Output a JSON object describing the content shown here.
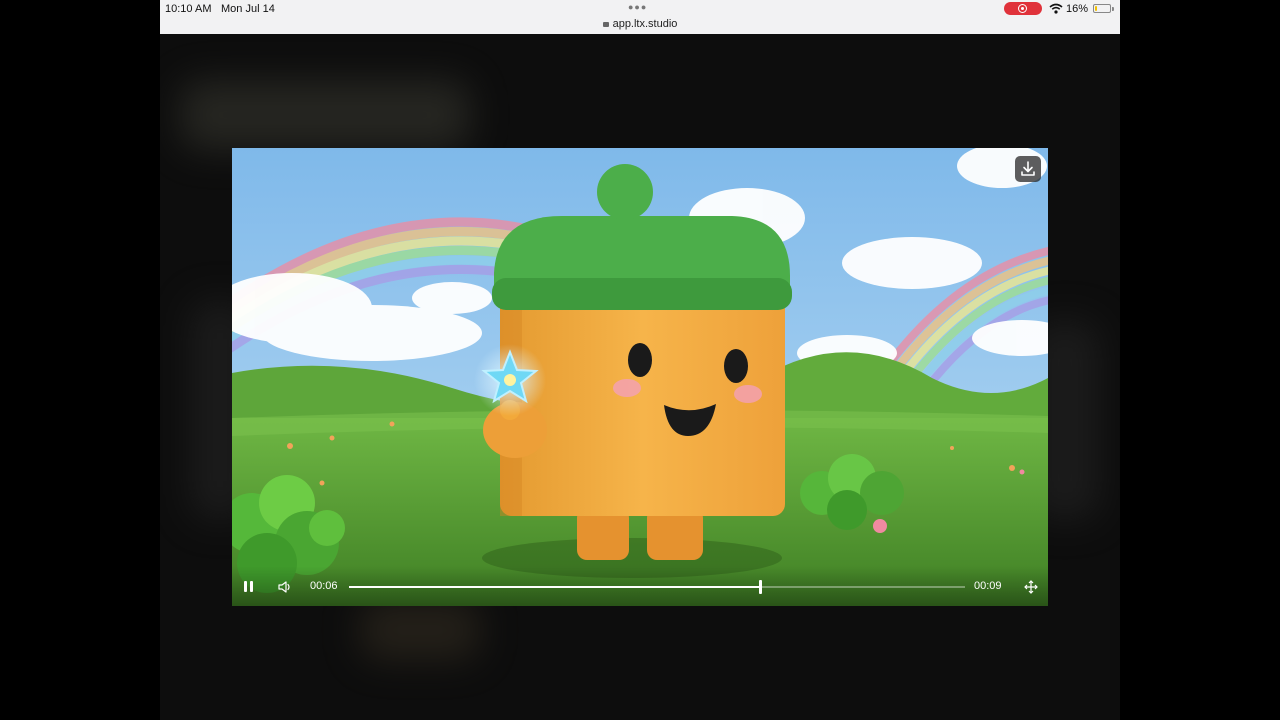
{
  "status_bar": {
    "time": "10:10 AM",
    "date": "Mon Jul 14",
    "url": "app.ltx.studio",
    "battery_text": "16%",
    "battery_level": 0.16,
    "icons": [
      "more-dots-icon",
      "lock-icon",
      "screen-record-icon",
      "wifi-icon",
      "battery-icon"
    ]
  },
  "player": {
    "current_time": "00:06",
    "duration": "00:09",
    "progress": 0.6667,
    "state": "playing",
    "icons": [
      "download-icon",
      "pause-icon",
      "volume-icon",
      "fullscreen-icon"
    ]
  },
  "colors": {
    "record": "#e0323a",
    "battery": "#f2c100",
    "sky": "#8fc6ee",
    "grass": "#5a9e34",
    "character": "#f2a93a",
    "hat": "#4cae4a"
  }
}
